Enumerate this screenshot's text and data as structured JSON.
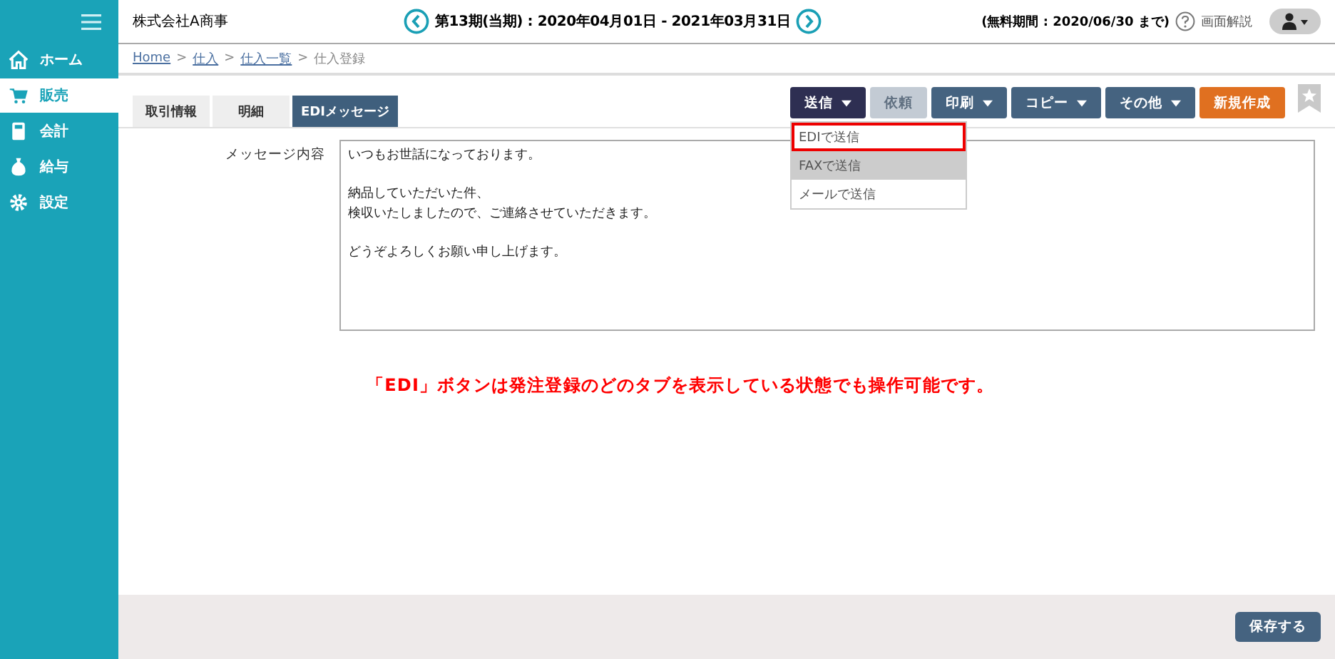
{
  "sidebar": {
    "items": [
      {
        "label": "ホーム",
        "selected": false
      },
      {
        "label": "販売",
        "selected": true
      },
      {
        "label": "会計",
        "selected": false
      },
      {
        "label": "給与",
        "selected": false
      },
      {
        "label": "設定",
        "selected": false
      }
    ]
  },
  "header": {
    "company": "株式会社A商事",
    "period": "第13期(当期) : 2020年04月01日 - 2021年03月31日",
    "trial": "(無料期間 : 2020/06/30 まで)",
    "help": "画面解説"
  },
  "breadcrumb": [
    {
      "label": "Home",
      "kind": "link"
    },
    {
      "label": ">",
      "kind": "separator"
    },
    {
      "label": "仕入",
      "kind": "link"
    },
    {
      "label": ">",
      "kind": "separator"
    },
    {
      "label": "仕入一覧",
      "kind": "link"
    },
    {
      "label": ">",
      "kind": "separator"
    },
    {
      "label": "仕入登録",
      "kind": "current"
    }
  ],
  "tabs": [
    {
      "label": "取引情報",
      "selected": false
    },
    {
      "label": "明細",
      "selected": false
    },
    {
      "label": "EDIメッセージ",
      "selected": true
    }
  ],
  "actions": [
    {
      "label": "送信",
      "kind": "menu",
      "caret": true,
      "open": true
    },
    {
      "label": "依頼",
      "kind": "disabled",
      "caret": false,
      "open": false
    },
    {
      "label": "印刷",
      "kind": "menu",
      "caret": true,
      "open": false
    },
    {
      "label": "コピー",
      "kind": "menu",
      "caret": true,
      "open": false
    },
    {
      "label": "その他",
      "kind": "menu",
      "caret": true,
      "open": false
    },
    {
      "label": "新規作成",
      "kind": "primary",
      "caret": false,
      "open": false
    }
  ],
  "send_menu": [
    {
      "label": "EDIで送信",
      "outlined": true,
      "hovered": false
    },
    {
      "label": "FAXで送信",
      "outlined": false,
      "hovered": true
    },
    {
      "label": "メールで送信",
      "outlined": false,
      "hovered": false
    }
  ],
  "message": {
    "label": "メッセージ内容",
    "paragraphs": [
      [
        "いつもお世話になっております。"
      ],
      [
        "納品していただいた件、",
        "検収いたしましたので、ご連絡させていただきます。"
      ],
      [
        "どうぞよろしくお願い申し上げます。"
      ]
    ]
  },
  "note": "「EDI」ボタンは発注登録のどのタブを表示している状態でも操作可能です。",
  "save_button": "保存する"
}
